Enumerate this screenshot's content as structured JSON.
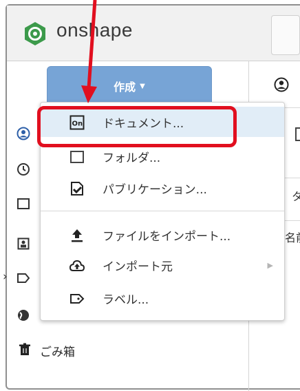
{
  "header": {
    "app_name": "onshape"
  },
  "sidebar": {
    "create_button_label": "作成",
    "trash_label": "ごみ箱"
  },
  "right_panel": {
    "fragment_1": "タ",
    "fragment_2": "名前"
  },
  "create_menu": {
    "items": [
      {
        "label": "ドキュメント...",
        "icon": "onshape-document-icon",
        "highlighted": true
      },
      {
        "label": "フォルダ...",
        "icon": "folder-icon",
        "highlighted": false
      },
      {
        "label": "パブリケーション...",
        "icon": "publication-icon",
        "highlighted": false
      },
      {
        "label": "ファイルをインポート...",
        "icon": "upload-icon",
        "highlighted": false
      },
      {
        "label": "インポート元",
        "icon": "cloud-upload-icon",
        "highlighted": false,
        "has_submenu": true
      },
      {
        "label": "ラベル...",
        "icon": "label-icon",
        "highlighted": false
      }
    ]
  },
  "colors": {
    "create_button": "#77a4d6",
    "highlight_row": "#e1edf7",
    "annotation_red": "#e10f1f",
    "logo_green": "#3c9a4b"
  }
}
